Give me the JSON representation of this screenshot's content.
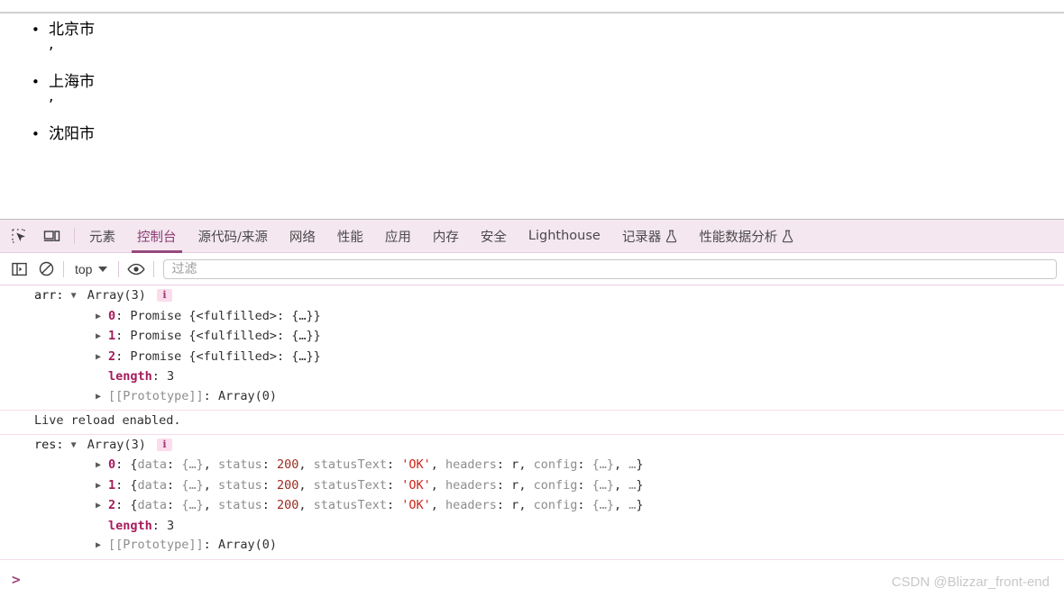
{
  "page": {
    "cities": [
      {
        "name": "北京市",
        "separator": ","
      },
      {
        "name": "上海市",
        "separator": ","
      },
      {
        "name": "沈阳市",
        "separator": ""
      }
    ]
  },
  "devtools": {
    "tabs": [
      {
        "label": "元素",
        "active": false,
        "flask": false
      },
      {
        "label": "控制台",
        "active": true,
        "flask": false
      },
      {
        "label": "源代码/来源",
        "active": false,
        "flask": false
      },
      {
        "label": "网络",
        "active": false,
        "flask": false
      },
      {
        "label": "性能",
        "active": false,
        "flask": false
      },
      {
        "label": "应用",
        "active": false,
        "flask": false
      },
      {
        "label": "内存",
        "active": false,
        "flask": false
      },
      {
        "label": "安全",
        "active": false,
        "flask": false
      },
      {
        "label": "Lighthouse",
        "active": false,
        "flask": false
      },
      {
        "label": "记录器",
        "active": false,
        "flask": true
      },
      {
        "label": "性能数据分析",
        "active": false,
        "flask": true
      }
    ],
    "icons": {
      "inspect": "inspect-element-icon",
      "device": "device-toolbar-icon",
      "sidebar": "console-sidebar-icon",
      "clear": "clear-console-icon",
      "eye": "live-expression-icon"
    },
    "toolbar": {
      "context_value": "top",
      "filter_placeholder": "过滤",
      "filter_value": ""
    },
    "console": {
      "messages": [
        {
          "label": "arr:",
          "summary": "Array(3)",
          "badge": "i",
          "entries": [
            {
              "index": "0",
              "text": "Promise {<fulfilled>: {…}}"
            },
            {
              "index": "1",
              "text": "Promise {<fulfilled>: {…}}"
            },
            {
              "index": "2",
              "text": "Promise {<fulfilled>: {…}}"
            }
          ],
          "length_key": "length",
          "length_value": "3",
          "prototype": "[[Prototype]]",
          "prototype_value": "Array(0)"
        },
        {
          "text": "Live reload enabled."
        },
        {
          "label": "res:",
          "summary": "Array(3)",
          "badge": "i",
          "entries": [
            {
              "index": "0",
              "data_key": "data",
              "data_value": "{…}",
              "status_key": "status",
              "status_value": "200",
              "statustext_key": "statusText",
              "statustext_value": "'OK'",
              "headers_key": "headers",
              "headers_value": "r",
              "config_key": "config",
              "config_value": "{…}",
              "rest": "…"
            },
            {
              "index": "1",
              "data_key": "data",
              "data_value": "{…}",
              "status_key": "status",
              "status_value": "200",
              "statustext_key": "statusText",
              "statustext_value": "'OK'",
              "headers_key": "headers",
              "headers_value": "r",
              "config_key": "config",
              "config_value": "{…}",
              "rest": "…"
            },
            {
              "index": "2",
              "data_key": "data",
              "data_value": "{…}",
              "status_key": "status",
              "status_value": "200",
              "statustext_key": "statusText",
              "statustext_value": "'OK'",
              "headers_key": "headers",
              "headers_value": "r",
              "config_key": "config",
              "config_value": "{…}",
              "rest": "…"
            }
          ],
          "length_key": "length",
          "length_value": "3",
          "prototype": "[[Prototype]]",
          "prototype_value": "Array(0)"
        }
      ],
      "prompt_caret": ">"
    }
  },
  "watermark": "CSDN @Blizzar_front-end",
  "colors": {
    "tabbar_bg": "#f4e7f0",
    "active_tab": "#96497e",
    "index": "#a61b5c",
    "string": "#cc2418",
    "number": "#9c2b1e",
    "key": "#8d8d8d",
    "separator": "#f6dcec"
  }
}
